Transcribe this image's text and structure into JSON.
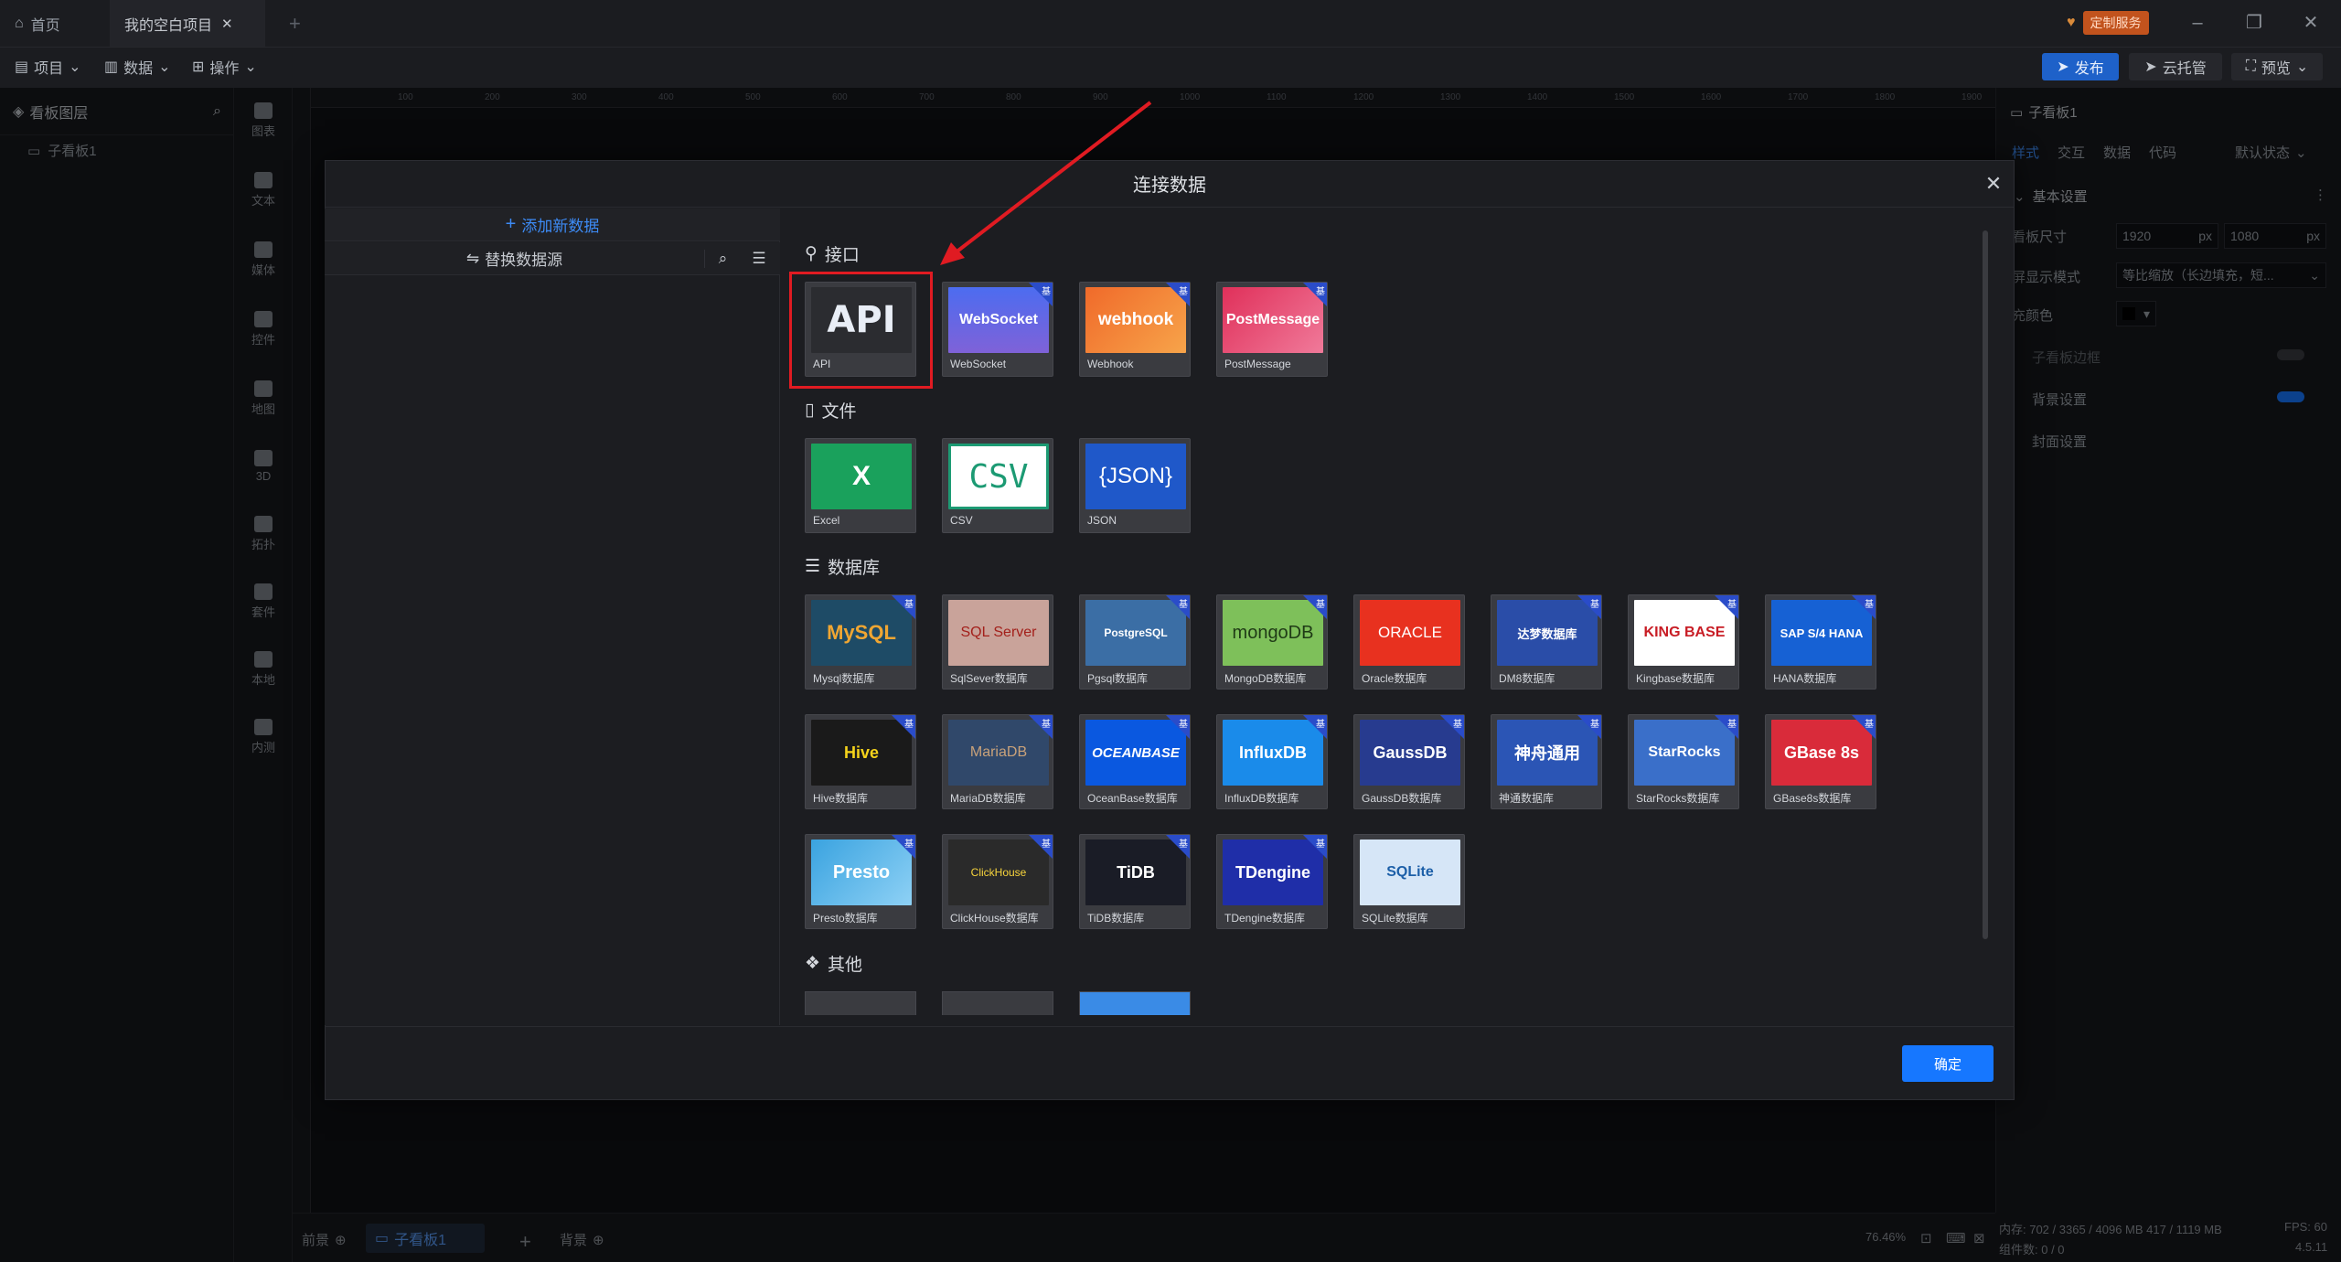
{
  "titlebar": {
    "home_tab": "首页",
    "project_tab": "我的空白项目",
    "custom_service": "定制服务"
  },
  "toolbar": {
    "project": "项目",
    "data": "数据",
    "operation": "操作",
    "publish": "发布",
    "cloud": "云托管",
    "preview": "预览"
  },
  "layers": {
    "title": "看板图层",
    "item": "子看板1"
  },
  "rail": [
    "图表",
    "文本",
    "媒体",
    "控件",
    "地图",
    "3D",
    "拓扑",
    "套件",
    "本地",
    "内测"
  ],
  "ruler": [
    "100",
    "200",
    "300",
    "400",
    "500",
    "600",
    "700",
    "800",
    "900",
    "1000",
    "1100",
    "1200",
    "1300",
    "1400",
    "1500",
    "1600",
    "1700",
    "1800",
    "1900"
  ],
  "props": {
    "board_name": "子看板1",
    "tabs": [
      "样式",
      "交互",
      "数据",
      "代码"
    ],
    "state": "默认状态",
    "basic": "基本设置",
    "size_label": "看板尺寸",
    "width": "1920",
    "height": "1080",
    "unit": "px",
    "display_label": "屏显示模式",
    "display_value": "等比缩放（长边填充，短...",
    "fill_label": "充颜色",
    "sub_border": "子看板边框",
    "bg": "背景设置",
    "cover": "封面设置"
  },
  "bottom": {
    "front": "前景",
    "board": "子看板1",
    "back": "背景",
    "zoom": "76.46%"
  },
  "status": {
    "memory": "内存: 702 / 3365 / 4096 MB  417 / 1119 MB",
    "fps": "FPS: 60",
    "components": "组件数: 0 / 0",
    "version": "4.5.11"
  },
  "modal": {
    "title": "连接数据",
    "add_data": "添加新数据",
    "switch_source": "替换数据源",
    "ok": "确定",
    "badge": "基",
    "sections": {
      "api": "接口",
      "file": "文件",
      "db": "数据库",
      "other": "其他"
    },
    "api_cards": [
      {
        "label": "API",
        "logo": "API"
      },
      {
        "label": "WebSocket",
        "logo": "WebSocket"
      },
      {
        "label": "Webhook",
        "logo": "webhook"
      },
      {
        "label": "PostMessage",
        "logo": "PostMessage"
      }
    ],
    "file_cards": [
      {
        "label": "Excel",
        "logo": "X"
      },
      {
        "label": "CSV",
        "logo": "CSV"
      },
      {
        "label": "JSON",
        "logo": "{JSON}"
      }
    ],
    "db_cards": [
      {
        "label": "Mysql数据库",
        "logo": "MySQL"
      },
      {
        "label": "SqlSever数据库",
        "logo": "SQL Server"
      },
      {
        "label": "Pgsql数据库",
        "logo": "PostgreSQL"
      },
      {
        "label": "MongoDB数据库",
        "logo": "mongoDB"
      },
      {
        "label": "Oracle数据库",
        "logo": "ORACLE"
      },
      {
        "label": "DM8数据库",
        "logo": "达梦数据库"
      },
      {
        "label": "Kingbase数据库",
        "logo": "KING BASE"
      },
      {
        "label": "HANA数据库",
        "logo": "SAP S/4 HANA"
      },
      {
        "label": "Hive数据库",
        "logo": "Hive"
      },
      {
        "label": "MariaDB数据库",
        "logo": "MariaDB"
      },
      {
        "label": "OceanBase数据库",
        "logo": "OCEANBASE"
      },
      {
        "label": "InfluxDB数据库",
        "logo": "InfluxDB"
      },
      {
        "label": "GaussDB数据库",
        "logo": "GaussDB"
      },
      {
        "label": "神通数据库",
        "logo": "神舟通用"
      },
      {
        "label": "StarRocks数据库",
        "logo": "StarRocks"
      },
      {
        "label": "GBase8s数据库",
        "logo": "GBase 8s"
      },
      {
        "label": "Presto数据库",
        "logo": "Presto"
      },
      {
        "label": "ClickHouse数据库",
        "logo": "ClickHouse"
      },
      {
        "label": "TiDB数据库",
        "logo": "TiDB"
      },
      {
        "label": "TDengine数据库",
        "logo": "TDengine"
      },
      {
        "label": "SQLite数据库",
        "logo": "SQLite"
      }
    ]
  },
  "colors": {
    "accent": "#1677ff",
    "highlight": "#e01b22"
  }
}
